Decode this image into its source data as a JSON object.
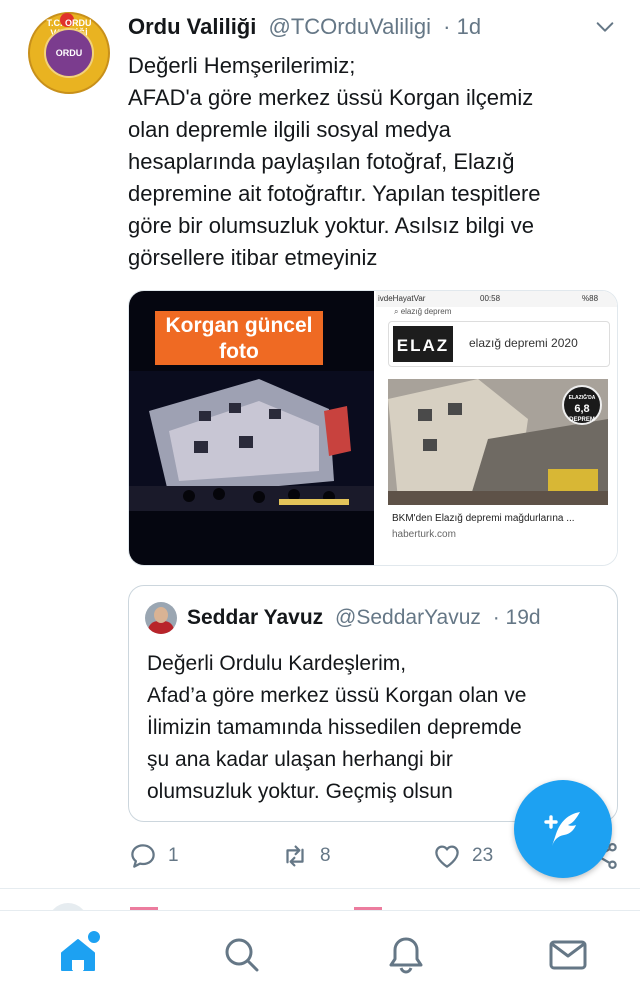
{
  "tweet": {
    "author_name": "Ordu Valiliği",
    "handle": "@TCOrduValiligi",
    "time": "· 1d",
    "avatar_text": "ORDU",
    "avatar_ring_text": "T.C. ORDU VALİLİĞİ",
    "body_lines": [
      "Değerli Hemşerilerimiz;",
      "AFAD'a göre merkez üssü Korgan ilçemiz",
      "olan depremle ilgili sosyal medya",
      "hesaplarında paylaşılan fotoğraf, Elazığ",
      "depremine ait fotoğraftır. Yapılan tespitlere",
      "göre bir olumsuzluk yoktur. Asılsız bilgi ve",
      "görsellere itibar etmeyiniz"
    ]
  },
  "media": {
    "left_banner": "Korgan güncel foto",
    "status_carrier": "ivdeHayatVar",
    "status_time": "00:58",
    "status_battery": "%88",
    "search_query": "elazığ deprem",
    "card_thumb_text": "ELAZ",
    "card_title": "elazığ depremi 2020",
    "magnitude_top": "ELAZIĞ'DA",
    "magnitude_value": "6,8",
    "magnitude_bottom": "DEPREM",
    "news_title": "BKM'den Elazığ depremi mağdurlarına ...",
    "news_domain": "haberturk.com"
  },
  "quote": {
    "author_name": "Seddar Yavuz",
    "handle": "@SeddarYavuz",
    "time": "· 19d",
    "body_lines": [
      "Değerli Ordulu Kardeşlerim,",
      "Afad’a göre merkez üssü Korgan olan ve",
      "İlimizin tamamında hissedilen depremde",
      "şu ana kadar ulaşan herhangi bir",
      "olumsuzluk yoktur. Geçmiş olsun"
    ]
  },
  "actions": {
    "reply_count": "1",
    "retweet_count": "8",
    "like_count": "23"
  },
  "icons": {
    "reply": "reply-icon",
    "retweet": "retweet-icon",
    "like": "heart-icon",
    "share": "share-icon",
    "compose": "compose-icon",
    "home": "home-icon",
    "search": "search-icon",
    "notifications": "bell-icon",
    "messages": "mail-icon"
  },
  "colors": {
    "accent": "#1da1f2",
    "secondary_text": "#657786",
    "banner": "#ef6a23"
  }
}
